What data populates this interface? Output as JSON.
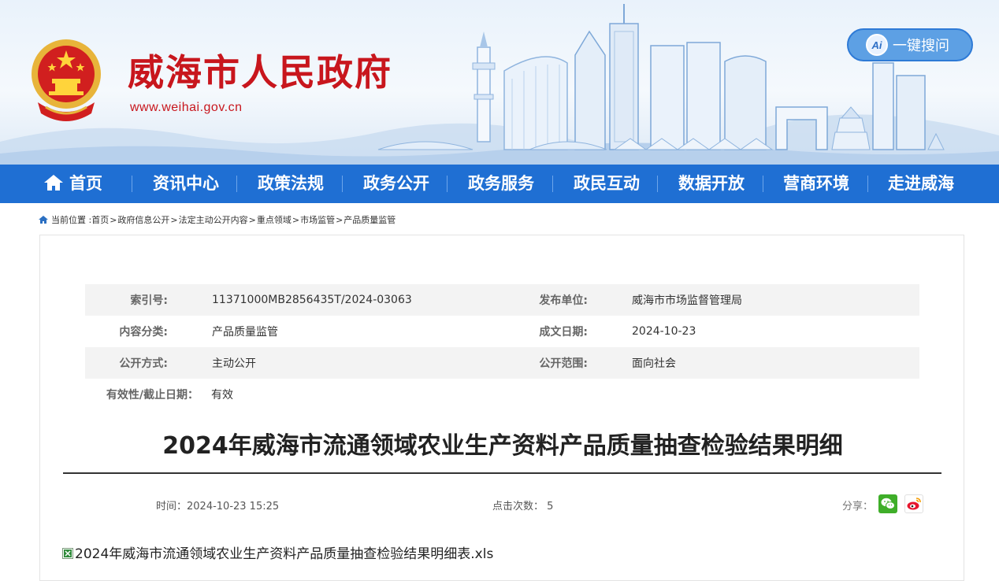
{
  "header": {
    "title": "威海市人民政府",
    "url": "www.weihai.gov.cn",
    "ai_search_label": "一键搜问",
    "ai_icon_text": "Ai"
  },
  "nav": {
    "items": [
      "首页",
      "资讯中心",
      "政策法规",
      "政务公开",
      "政务服务",
      "政民互动",
      "数据开放",
      "营商环境",
      "走进威海"
    ]
  },
  "breadcrumb": {
    "prefix": "当前位置 :",
    "items": [
      "首页",
      "政府信息公开",
      "法定主动公开内容",
      "重点领域",
      "市场监管",
      "产品质量监管"
    ],
    "separator": ">"
  },
  "meta": {
    "index_label": "索引号:",
    "index_value": "11371000MB2856435T/2024-03063",
    "publisher_label": "发布单位:",
    "publisher_value": "威海市市场监督管理局",
    "category_label": "内容分类:",
    "category_value": "产品质量监管",
    "date_label": "成文日期:",
    "date_value": "2024-10-23",
    "method_label": "公开方式:",
    "method_value": "主动公开",
    "scope_label": "公开范围:",
    "scope_value": "面向社会",
    "validity_label": "有效性/截止日期：",
    "validity_value": "有效"
  },
  "article": {
    "title": "2024年威海市流通领域农业生产资料产品质量抽查检验结果明细",
    "time": "时间：2024-10-23 15:25",
    "clicks_label": "点击次数：",
    "clicks_value": "5",
    "share_label": "分享：",
    "attachment": "2024年威海市流通领域农业生产资料产品质量抽查检验结果明细表.xls"
  },
  "colors": {
    "brand_red": "#c8161d",
    "nav_blue": "#1f6fd3",
    "wechat_green": "#3fae29"
  }
}
